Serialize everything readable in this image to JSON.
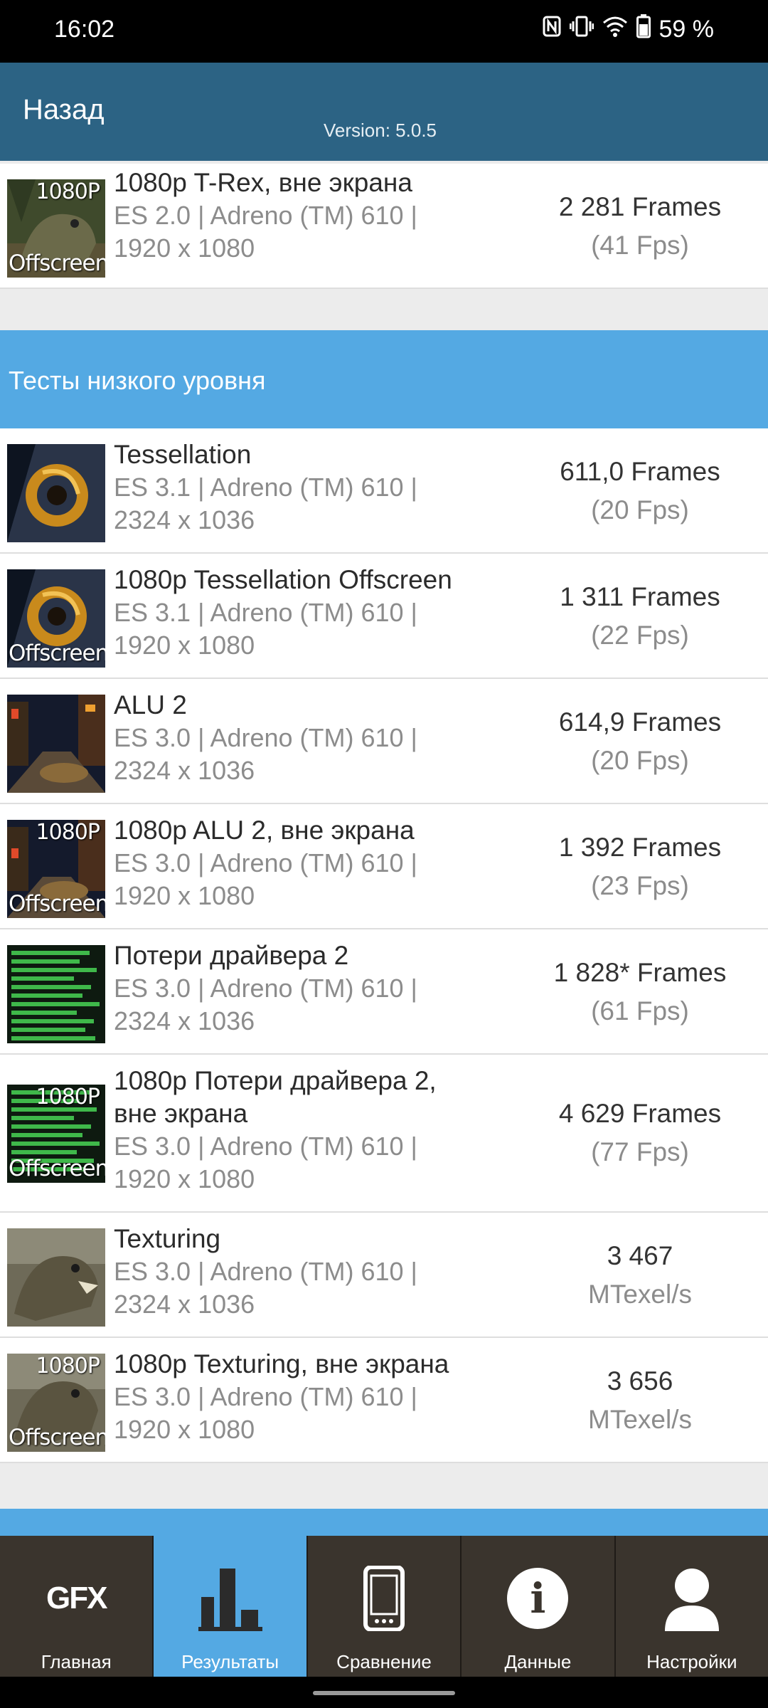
{
  "status_bar": {
    "time": "16:02",
    "battery": "59 %",
    "icons": [
      "nfc-icon",
      "vibrate-icon",
      "wifi-icon",
      "battery-icon"
    ]
  },
  "app_bar": {
    "back_label": "Назад",
    "version": "Version: 5.0.5"
  },
  "top_result": {
    "name": "1080p T-Rex, вне экрана",
    "api": "ES 2.0 | Adreno (TM) 610 |",
    "resolution": "1920 x 1080",
    "score": "2 281 Frames",
    "fps": "(41 Fps)",
    "thumb_top": "1080P",
    "thumb_bottom": "Offscreen"
  },
  "section": {
    "title": "Тесты низкого уровня"
  },
  "results": [
    {
      "name": "Tessellation",
      "api": "ES 3.1 | Adreno (TM) 610 |",
      "resolution": "2324 x 1036",
      "score": "611,0 Frames",
      "fps": "(20 Fps)",
      "thumb_top": "",
      "thumb_bottom": ""
    },
    {
      "name": "1080p Tessellation Offscreen",
      "api": "ES 3.1 | Adreno (TM) 610 |",
      "resolution": "1920 x 1080",
      "score": "1 311 Frames",
      "fps": "(22 Fps)",
      "thumb_top": "",
      "thumb_bottom": "Offscreen"
    },
    {
      "name": "ALU 2",
      "api": "ES 3.0 | Adreno (TM) 610 |",
      "resolution": "2324 x 1036",
      "score": "614,9 Frames",
      "fps": "(20 Fps)",
      "thumb_top": "",
      "thumb_bottom": ""
    },
    {
      "name": "1080p ALU 2, вне экрана",
      "api": "ES 3.0 | Adreno (TM) 610 |",
      "resolution": "1920 x 1080",
      "score": "1 392 Frames",
      "fps": "(23 Fps)",
      "thumb_top": "1080P",
      "thumb_bottom": "Offscreen"
    },
    {
      "name": "Потери драйвера 2",
      "api": "ES 3.0 | Adreno (TM) 610 |",
      "resolution": "2324 x 1036",
      "score": "1 828* Frames",
      "fps": "(61 Fps)",
      "thumb_top": "",
      "thumb_bottom": ""
    },
    {
      "name": "1080p Потери драйвера 2,",
      "name2": "вне экрана",
      "api": "ES 3.0 | Adreno (TM) 610 |",
      "resolution": "1920 x 1080",
      "score": "4 629 Frames",
      "fps": "(77 Fps)",
      "thumb_top": "1080P",
      "thumb_bottom": "Offscreen"
    },
    {
      "name": "Texturing",
      "api": "ES 3.0 | Adreno (TM) 610 |",
      "resolution": "2324 x 1036",
      "score": "3 467",
      "fps": "MTexel/s",
      "thumb_top": "",
      "thumb_bottom": ""
    },
    {
      "name": "1080p Texturing, вне экрана",
      "api": "ES 3.0 | Adreno (TM) 610 |",
      "resolution": "1920 x 1080",
      "score": "3 656",
      "fps": "MTexel/s",
      "thumb_top": "1080P",
      "thumb_bottom": "Offscreen"
    }
  ],
  "bottom_nav": [
    {
      "label": "Главная",
      "icon": "gfx-logo-icon",
      "active": false,
      "glyph": "GFX"
    },
    {
      "label": "Результаты",
      "icon": "bar-chart-icon",
      "active": true
    },
    {
      "label": "Сравнение",
      "icon": "phone-icon",
      "active": false
    },
    {
      "label": "Данные",
      "icon": "info-icon",
      "active": false,
      "glyph": "i"
    },
    {
      "label": "Настройки",
      "icon": "user-icon",
      "active": false
    }
  ],
  "colors": {
    "app_bar": "#2c6384",
    "section_header": "#54a9e3",
    "nav_bg": "#3a342d",
    "nav_active": "#54a9e3"
  }
}
